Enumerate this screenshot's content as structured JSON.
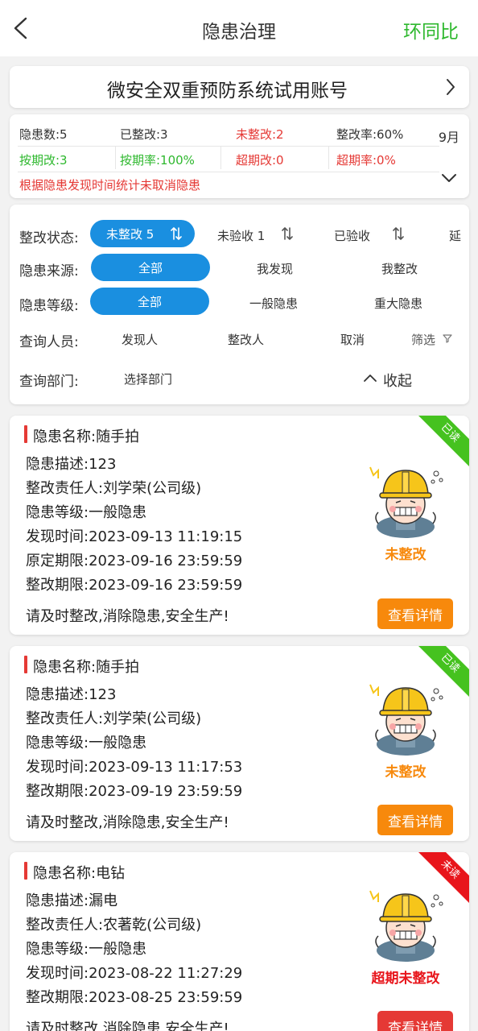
{
  "header": {
    "title": "隐患治理",
    "action_label": "环同比"
  },
  "account": {
    "name": "微安全双重预防系统试用账号"
  },
  "stats": {
    "total": "隐患数:5",
    "rectified": "已整改:3",
    "unrectified": "未整改:2",
    "rectify_rate": "整改率:60%",
    "on_time": "按期改:3",
    "on_time_rate": "按期率:100%",
    "overdue": "超期改:0",
    "overdue_rate": "超期率:0%",
    "month": "9月",
    "note": "根据隐患发现时间统计未取消隐患",
    "colors": {
      "green": "#2eb82e",
      "red": "#e53935"
    }
  },
  "filters": {
    "status_label": "整改状态:",
    "status_options": [
      "未整改 5",
      "未验收 1",
      "已验收",
      "延"
    ],
    "source_label": "隐患来源:",
    "source_options": [
      "全部",
      "我发现",
      "我整改"
    ],
    "level_label": "隐患等级:",
    "level_options": [
      "全部",
      "一般隐患",
      "重大隐患"
    ],
    "person_label": "查询人员:",
    "person_options": [
      "发现人",
      "整改人",
      "取消",
      "筛选"
    ],
    "dept_label": "查询部门:",
    "dept_placeholder": "选择部门",
    "collapse_label": "收起",
    "accent": "#1a8fe0"
  },
  "hazards": [
    {
      "name": "隐患名称:随手拍",
      "desc": "隐患描述:123",
      "owner": "整改责任人:刘学荣(公司级)",
      "level": "隐患等级:一般隐患",
      "found": "发现时间:2023-09-13 11:19:15",
      "orig_deadline": "原定期限:2023-09-16 23:59:59",
      "deadline": "整改期限:2023-09-16 23:59:59",
      "slogan": "请及时整改,消除隐患,安全生产!",
      "status": "未整改",
      "ribbon": "已读",
      "button": "查看详情"
    },
    {
      "name": "隐患名称:随手拍",
      "desc": "隐患描述:123",
      "owner": "整改责任人:刘学荣(公司级)",
      "level": "隐患等级:一般隐患",
      "found": "发现时间:2023-09-13 11:17:53",
      "deadline": "整改期限:2023-09-19 23:59:59",
      "slogan": "请及时整改,消除隐患,安全生产!",
      "status": "未整改",
      "ribbon": "已读",
      "button": "查看详情"
    },
    {
      "name": "隐患名称:电钻",
      "desc": "隐患描述:漏电",
      "owner": "整改责任人:农著乾(公司级)",
      "level": "隐患等级:一般隐患",
      "found": "发现时间:2023-08-22 11:27:29",
      "deadline": "整改期限:2023-08-25 23:59:59",
      "slogan": "请及时整改,消除隐患,安全生产!",
      "status": "超期未整改",
      "ribbon": "未读",
      "button": "查看详情"
    }
  ]
}
